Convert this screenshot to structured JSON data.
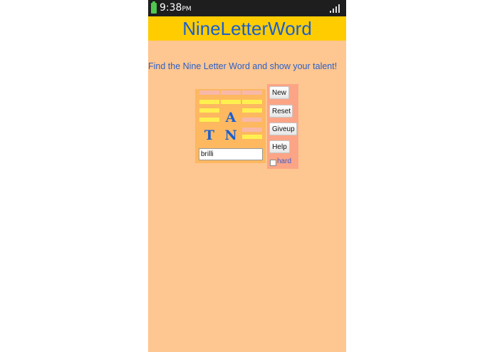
{
  "status_bar": {
    "time": "9:38",
    "ampm": "PM",
    "battery_icon": "battery-icon",
    "signal_icon": "signal-bars-icon"
  },
  "app": {
    "title": "NineLetterWord",
    "instruction": "Find the Nine Letter Word and show your talent!"
  },
  "board": {
    "rows": [
      [
        {
          "letter": "",
          "style": "pink-yellow"
        },
        {
          "letter": "",
          "style": "pink-yellow"
        },
        {
          "letter": "",
          "style": "pink-yellow"
        }
      ],
      [
        {
          "letter": "",
          "style": "yellow-yellow"
        },
        {
          "letter": "A",
          "style": "letter"
        },
        {
          "letter": "",
          "style": "yellow-pink"
        }
      ],
      [
        {
          "letter": "T",
          "style": "letter"
        },
        {
          "letter": "N",
          "style": "letter"
        },
        {
          "letter": "",
          "style": "pink-yellow"
        }
      ]
    ],
    "guess_value": "brilli"
  },
  "controls": {
    "new_label": "New",
    "reset_label": "Reset",
    "giveup_label": "Giveup",
    "help_label": "Help",
    "hard_label": "hard",
    "hard_checked": false
  },
  "colors": {
    "background": "#fec690",
    "title_bar": "#ffcc00",
    "title_text": "#1a5fd0",
    "instruction_text": "#2a5fc8",
    "board": "#fdb860",
    "controls_panel": "#fba586"
  }
}
